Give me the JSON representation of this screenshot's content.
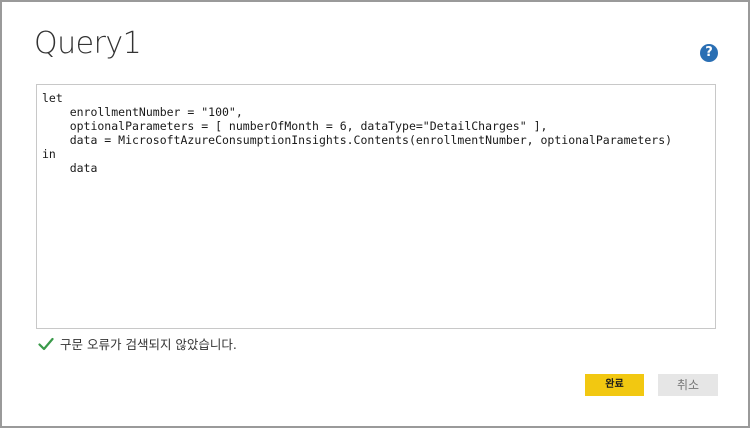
{
  "dialog": {
    "title": "Query1",
    "help_icon": "help-icon",
    "help_label": "?"
  },
  "editor": {
    "lines": [
      {
        "text": "let"
      },
      {
        "text": "    enrollmentNumber = \"100\","
      },
      {
        "text": "    optionalParameters = [ numberOfMonth = 6, dataType=\"DetailCharges\" ],"
      },
      {
        "text": "    data = MicrosoftAzureConsumptionInsights.Contents(enrollmentNumber, optionalParameters)"
      },
      {
        "text": "in"
      },
      {
        "text": "    data"
      }
    ]
  },
  "status": {
    "icon": "check-icon",
    "text": "구문 오류가 검색되지 않았습니다.",
    "color": "#3a9a4a"
  },
  "buttons": {
    "done_label": "완료",
    "cancel_label": "취소"
  },
  "colors": {
    "accent": "#f2c811",
    "help": "#2a6fb4"
  }
}
